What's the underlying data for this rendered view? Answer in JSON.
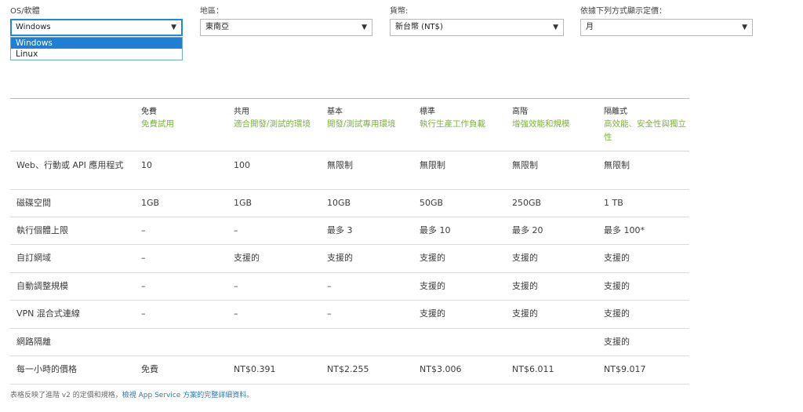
{
  "filters": {
    "os": {
      "label": "OS/軟體",
      "value": "Windows",
      "options": [
        "Windows",
        "Linux"
      ]
    },
    "region": {
      "label": "地區：",
      "value": "東南亞"
    },
    "currency": {
      "label": "貨幣:",
      "value": "新台幣 (NT$)"
    },
    "period": {
      "label": "依據下列方式顯示定價：",
      "value": "月"
    }
  },
  "tiers": [
    {
      "name": "免費",
      "desc": "免費試用"
    },
    {
      "name": "共用",
      "desc": "適合開發/測試的環境"
    },
    {
      "name": "基本",
      "desc": "開發/測試專用環境"
    },
    {
      "name": "標準",
      "desc": "執行生產工作負載"
    },
    {
      "name": "高階",
      "desc": "增強效能和規模"
    },
    {
      "name": "隔離式",
      "desc": "高效能、安全性與獨立性"
    }
  ],
  "rows": [
    {
      "label": "Web、行動或 API 應用程式",
      "values": [
        "10",
        "100",
        "無限制",
        "無限制",
        "無限制",
        "無限制"
      ]
    },
    {
      "label": "磁碟空間",
      "values": [
        "1GB",
        "1GB",
        "10GB",
        "50GB",
        "250GB",
        "1 TB"
      ]
    },
    {
      "label": "執行個體上限",
      "values": [
        "–",
        "–",
        "最多 3",
        "最多 10",
        "最多 20",
        "最多 100*"
      ]
    },
    {
      "label": "自訂網域",
      "values": [
        "–",
        "支援的",
        "支援的",
        "支援的",
        "支援的",
        "支援的"
      ]
    },
    {
      "label": "自動調整規模",
      "values": [
        "–",
        "–",
        "–",
        "支援的",
        "支援的",
        "支援的"
      ]
    },
    {
      "label": "VPN 混合式連線",
      "values": [
        "–",
        "–",
        "–",
        "支援的",
        "支援的",
        "支援的"
      ]
    },
    {
      "label": "網路隔離",
      "values": [
        "",
        "",
        "",
        "",
        "",
        "支援的"
      ]
    },
    {
      "label": "每一小時的價格",
      "values": [
        "免費",
        "NT$0.391",
        "NT$2.255",
        "NT$3.006",
        "NT$6.011",
        "NT$9.017"
      ]
    }
  ],
  "footnote": {
    "text": "表格反映了進階 v2 的定價和規格，",
    "link": "檢視 App Service 方案的完整詳細資料",
    "end": "。"
  },
  "colors": {
    "accent_green": "#7bb53a",
    "focus_blue": "#1f8ad6",
    "selected_blue": "#1e7fd4",
    "link": "#2b7cc2"
  },
  "icons": {
    "dropdown": "caret-down-icon"
  }
}
